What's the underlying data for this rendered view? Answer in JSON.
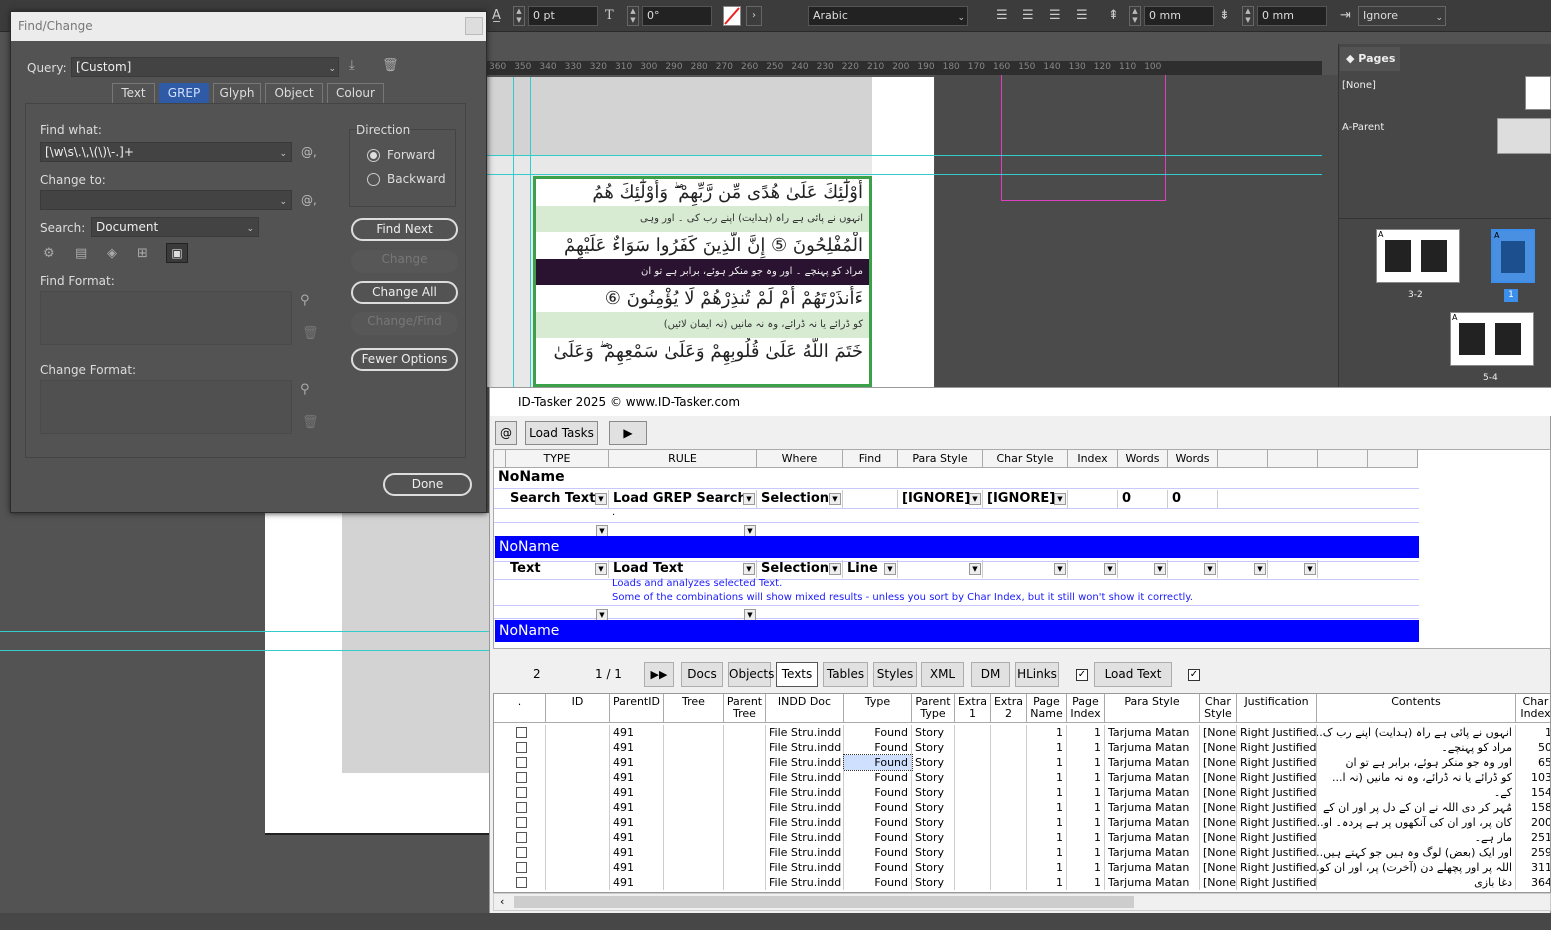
{
  "control_bar": {
    "tracking": "0 pt",
    "skew": "0°",
    "language": "Arabic",
    "indent_left": "0 mm",
    "indent_right": "0 mm",
    "ignore_value": "Ignore"
  },
  "ruler": [
    "360",
    "350",
    "340",
    "330",
    "320",
    "310",
    "300",
    "290",
    "280",
    "270",
    "260",
    "250",
    "240",
    "230",
    "220",
    "210",
    "200",
    "190",
    "180",
    "170",
    "160",
    "150",
    "140",
    "130",
    "120",
    "110",
    "100"
  ],
  "quran": {
    "lines": [
      "أُوْلَٰٓئِكَ عَلَىٰ هُدًى مِّن رَّبِّهِمْ ۖ وَأُوْلَٰٓئِكَ هُمُ",
      "انہوں نے پائی ہے راہ (ہدایت) اپنے رب کی ۔ اور وہی",
      "الْمُفْلِحُونَ ⑤ إِنَّ الَّذِينَ كَفَرُوا سَوَاءٌ عَلَيْهِمْ",
      "مراد کو پہنچے ۔ اور وہ جو منکر ہوئے، برابر ہے تو ان",
      "ءَأَنذَرْتَهُمْ أَمْ لَمْ تُنذِرْهُمْ لَا يُؤْمِنُونَ ⑥",
      "کو ڈرائے یا نہ ڈرائے، وہ نہ مانیں (نہ ایمان لائیں)",
      "خَتَمَ اللَّهُ عَلَىٰ قُلُوبِهِمْ وَعَلَىٰ سَمْعِهِمْ ۖ وَعَلَىٰ"
    ]
  },
  "pages_panel": {
    "tab": "Pages",
    "none_label": "[None]",
    "parent_label": "A-Parent",
    "spread_1": "3-2",
    "page_num": "1",
    "spread_2": "5-4",
    "marker_a": "A"
  },
  "find_change": {
    "title": "Find/Change",
    "query_label": "Query:",
    "query_value": "[Custom]",
    "tabs": [
      "Text",
      "GREP",
      "Glyph",
      "Object",
      "Colour"
    ],
    "find_label": "Find what:",
    "find_value": "[\\w\\s\\.\\,\\(\\)\\-.]+",
    "change_label": "Change to:",
    "change_value": "",
    "search_label": "Search:",
    "search_value": "Document",
    "direction_label": "Direction",
    "forward": "Forward",
    "backward": "Backward",
    "buttons": {
      "find_next": "Find Next",
      "change": "Change",
      "change_all": "Change All",
      "change_find": "Change/Find",
      "fewer": "Fewer Options",
      "done": "Done"
    },
    "find_format_label": "Find Format:",
    "change_format_label": "Change Format:",
    "at_symbol": "@,"
  },
  "id_tasker": {
    "title": "ID-Tasker 2025   © www.ID-Tasker.com",
    "at_btn": "@",
    "load_tasks": "Load Tasks",
    "play": "▶",
    "headers": [
      "TYPE",
      "RULE",
      "Where",
      "Find",
      "Para Style",
      "Char Style",
      "Index",
      "Words",
      "Words",
      "",
      "",
      ""
    ],
    "group1": "NoName",
    "row1": {
      "type": "Search Text",
      "rule": "Load GREP Search",
      "where": "Selection",
      "para": "[IGNORE]",
      "char": "[IGNORE]",
      "w1": "0",
      "w2": "0",
      "dot": "."
    },
    "group2": "NoName",
    "row2": {
      "type": "Text",
      "rule": "Load Text",
      "where": "Selection",
      "find": "Line",
      "desc1": "Loads and analyzes selected Text.",
      "desc2": "Some of the combinations will show mixed results - unless you sort by Char Index, but it still won't show it correctly."
    },
    "group3": "NoName",
    "toolbar": {
      "count": "2",
      "page": "1 / 1",
      "ff": "▶▶",
      "tabs": [
        "Docs",
        "Objects",
        "Texts",
        "Tables",
        "Styles",
        "XML",
        "DM",
        "HLinks"
      ],
      "load_text": "Load Text"
    },
    "table_headers": [
      ".",
      "ID",
      "ParentID",
      "Tree",
      "Parent Tree",
      "INDD Doc",
      "Type",
      "Parent Type",
      "Extra 1",
      "Extra 2",
      "Page Name",
      "Page Index",
      "Para Style",
      "Char Style",
      "Justification",
      "Contents",
      "Char Index"
    ],
    "rows": [
      {
        "parent": "491",
        "doc": "File Stru.indd",
        "type": "Found",
        "ptype": "Story",
        "page": "1",
        "pidx": "1",
        "para": "Tarjuma Matan",
        "char": "[None]",
        "just": "Right Justified",
        "contents": "انہوں نے پائی ہے راہ (ہدایت) اپنے رب ک...",
        "idx": "1"
      },
      {
        "parent": "491",
        "doc": "File Stru.indd",
        "type": "Found",
        "ptype": "Story",
        "page": "1",
        "pidx": "1",
        "para": "Tarjuma Matan",
        "char": "[None]",
        "just": "Right Justified",
        "contents": "مراد کو پہنچے۔",
        "idx": "50"
      },
      {
        "parent": "491",
        "doc": "File Stru.indd",
        "type": "Found",
        "ptype": "Story",
        "page": "1",
        "pidx": "1",
        "para": "Tarjuma Matan",
        "char": "[None]",
        "just": "Right Justified",
        "contents": "اور وہ جو منکر ہوئے، برابر ہے تو ان",
        "idx": "65"
      },
      {
        "parent": "491",
        "doc": "File Stru.indd",
        "type": "Found",
        "ptype": "Story",
        "page": "1",
        "pidx": "1",
        "para": "Tarjuma Matan",
        "char": "[None]",
        "just": "Right Justified",
        "contents": "کو ڈرائے یا نہ ڈرائے، وہ نہ مانیں (نہ ا...",
        "idx": "103"
      },
      {
        "parent": "491",
        "doc": "File Stru.indd",
        "type": "Found",
        "ptype": "Story",
        "page": "1",
        "pidx": "1",
        "para": "Tarjuma Matan",
        "char": "[None]",
        "just": "Right Justified",
        "contents": "کے۔",
        "idx": "154"
      },
      {
        "parent": "491",
        "doc": "File Stru.indd",
        "type": "Found",
        "ptype": "Story",
        "page": "1",
        "pidx": "1",
        "para": "Tarjuma Matan",
        "char": "[None]",
        "just": "Right Justified",
        "contents": "مُہر کر دی اللہ نے ان کے دل پر اور ان کے",
        "idx": "158"
      },
      {
        "parent": "491",
        "doc": "File Stru.indd",
        "type": "Found",
        "ptype": "Story",
        "page": "1",
        "pidx": "1",
        "para": "Tarjuma Matan",
        "char": "[None]",
        "just": "Right Justified",
        "contents": "کان پر، اور ان کی آنکھوں پر ہے پردہ۔ او...",
        "idx": "200"
      },
      {
        "parent": "491",
        "doc": "File Stru.indd",
        "type": "Found",
        "ptype": "Story",
        "page": "1",
        "pidx": "1",
        "para": "Tarjuma Matan",
        "char": "[None]",
        "just": "Right Justified",
        "contents": "مار ہے۔",
        "idx": "251"
      },
      {
        "parent": "491",
        "doc": "File Stru.indd",
        "type": "Found",
        "ptype": "Story",
        "page": "1",
        "pidx": "1",
        "para": "Tarjuma Matan",
        "char": "[None]",
        "just": "Right Justified",
        "contents": "اور ایک (بعض) لوگ وہ ہیں جو کہتے ہیں...",
        "idx": "259"
      },
      {
        "parent": "491",
        "doc": "File Stru.indd",
        "type": "Found",
        "ptype": "Story",
        "page": "1",
        "pidx": "1",
        "para": "Tarjuma Matan",
        "char": "[None]",
        "just": "Right Justified",
        "contents": "اللہ پر اور پچھلے دن (آخرت) پر، اور ان کو...",
        "idx": "311"
      },
      {
        "parent": "491",
        "doc": "File Stru.indd",
        "type": "Found",
        "ptype": "Story",
        "page": "1",
        "pidx": "1",
        "para": "Tarjuma Matan",
        "char": "[None]",
        "just": "Right Justified",
        "contents": "دغا بازی",
        "idx": "364"
      }
    ]
  }
}
